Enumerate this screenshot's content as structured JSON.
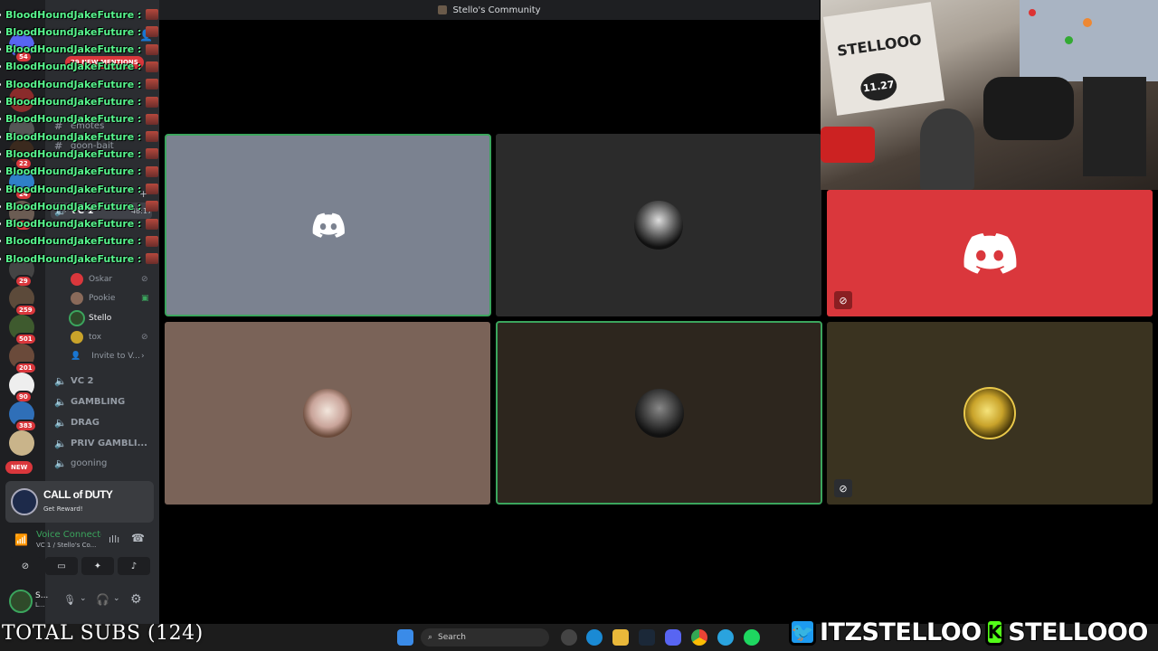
{
  "window": {
    "title": "Stello's Community"
  },
  "server_badges": [
    "54",
    "22",
    "24",
    "74",
    "29",
    "259",
    "501",
    "201",
    "90",
    "383"
  ],
  "new_pill": "NEW",
  "mentions_pill": "29 NEW MENTIONS",
  "channels": {
    "text": [
      "emotes",
      "goon-bait"
    ],
    "voice": [
      {
        "name": "VC 1",
        "time": "48:17"
      },
      {
        "name": "VC 2"
      },
      {
        "name": "GAMBLING"
      },
      {
        "name": "DRAG"
      },
      {
        "name": "PRIV GAMBLI..."
      },
      {
        "name": "gooning"
      }
    ],
    "vc1_users": [
      "Oskar",
      "Pookie",
      "Stello",
      "tox"
    ],
    "invite_label": "Invite to V..."
  },
  "chat_overlay": {
    "name": "BloodHoundJakeFuture :",
    "lines": 15
  },
  "promo": {
    "title": "CALL of DUTY",
    "subtitle": "Get Reward!"
  },
  "voice_panel": {
    "status": "Voice Connected",
    "location": "VC 1 / Stello's Co..."
  },
  "user_panel": {
    "name": "S...",
    "sub": "L..."
  },
  "taskbar": {
    "search_placeholder": "Search"
  },
  "overlay": {
    "subs": "TOTAL SUBS (124)",
    "twitter": "ITZSTELLOO",
    "kick": "STELLOOO"
  },
  "webcam": {
    "sign_text": "STELLOOO",
    "sign_text2": "11.27"
  },
  "colors": {
    "speaking": "#3ba55d",
    "tile_gray": "#7b8290",
    "tile_dark": "#2b2b2b",
    "tile_red": "#da373c",
    "tile_tan": "#7a6358",
    "tile_brown": "#2d261e",
    "tile_olive": "#3a3320",
    "kick_green": "#53fc18",
    "twitter_blue": "#1d9bf0"
  }
}
